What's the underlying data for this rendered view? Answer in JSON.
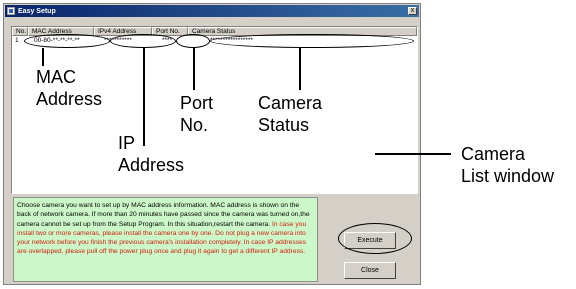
{
  "window": {
    "title": "Easy Setup",
    "close_label": "x"
  },
  "list": {
    "columns": [
      "No.",
      "MAC Address",
      "IPv4 Address",
      "Port No.",
      "Camera Status"
    ],
    "rows": [
      {
        "no": "1",
        "mac": "00-80-**-**-**-**",
        "ip": "***********",
        "port": "****",
        "status": "*****************"
      }
    ]
  },
  "callouts": {
    "mac_line1": "MAC",
    "mac_line2": "Address",
    "ip_line1": "IP",
    "ip_line2": "Address",
    "port_line1": "Port",
    "port_line2": "No.",
    "status_line1": "Camera",
    "status_line2": "Status",
    "list_window_line1": "Camera",
    "list_window_line2": "List window"
  },
  "info": {
    "black_text": "Choose camera you want to set up by MAC address information. MAC address is shown on the back of network camera. If more than 20 minutes have passed since the camera was turned on,the camera cannot be set up from the Setup Program. In this situation,restart the camera.",
    "red_text": "In case you install two or more cameras, please install the camera one by one. Do not plug a new camera into your network before you finish the previous camera's installation completely. In case IP addresses are overlapped, please pull off the power plug once and plug it again to get a different IP address."
  },
  "buttons": {
    "execute": "Execute",
    "close": "Close"
  }
}
